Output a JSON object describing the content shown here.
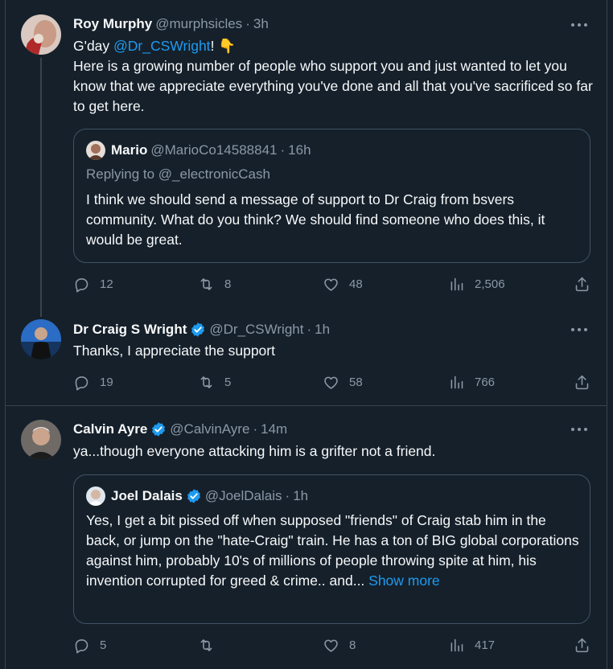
{
  "tweets": [
    {
      "name": "Roy Murphy",
      "handle": "@murphsicles",
      "time": "3h",
      "verified": false,
      "text_prefix": "G'day ",
      "mention": "@Dr_CSWright",
      "text_suffix": "! 👇",
      "text_line2": "Here is a growing number of people who support you and just wanted to let you know that we appreciate everything you've done and all that you've sacrificed so far to get here.",
      "quote": {
        "name": "Mario",
        "handle": "@MarioCo14588841",
        "time": "16h",
        "replying_label": "Replying to ",
        "replying_to": "@_electronicCash",
        "text": "I think we should send a message of support to Dr Craig from bsvers community. What do you think? We should find someone who does this, it would be great."
      },
      "stats": {
        "replies": "12",
        "reposts": "8",
        "likes": "48",
        "views": "2,506"
      }
    },
    {
      "name": "Dr Craig S Wright",
      "handle": "@Dr_CSWright",
      "time": "1h",
      "verified": true,
      "text": "Thanks, I appreciate the support",
      "stats": {
        "replies": "19",
        "reposts": "5",
        "likes": "58",
        "views": "766"
      }
    },
    {
      "name": "Calvin Ayre",
      "handle": "@CalvinAyre",
      "time": "14m",
      "verified": true,
      "text": "ya...though everyone attacking him is a grifter not a friend.",
      "quote": {
        "name": "Joel Dalais",
        "handle": "@JoelDalais",
        "time": "1h",
        "text": "Yes, I get a bit pissed off when supposed \"friends\" of Craig stab him in the back, or jump on the \"hate-Craig\" train. He has a ton of BIG global corporations against him, probably 10's of millions of people throwing spite at him, his invention corrupted for greed & crime.. and... ",
        "show_more": "Show more"
      },
      "stats": {
        "replies": "5",
        "reposts": "",
        "likes": "8",
        "views": "417"
      }
    }
  ],
  "colors": {
    "background": "#15202b",
    "accent": "#1d9bf0",
    "secondary_text": "#8b98a5",
    "border": "#38444d"
  },
  "icons": [
    "more-icon",
    "verified-badge-icon",
    "reply-icon",
    "repost-icon",
    "like-icon",
    "views-icon",
    "share-icon"
  ]
}
